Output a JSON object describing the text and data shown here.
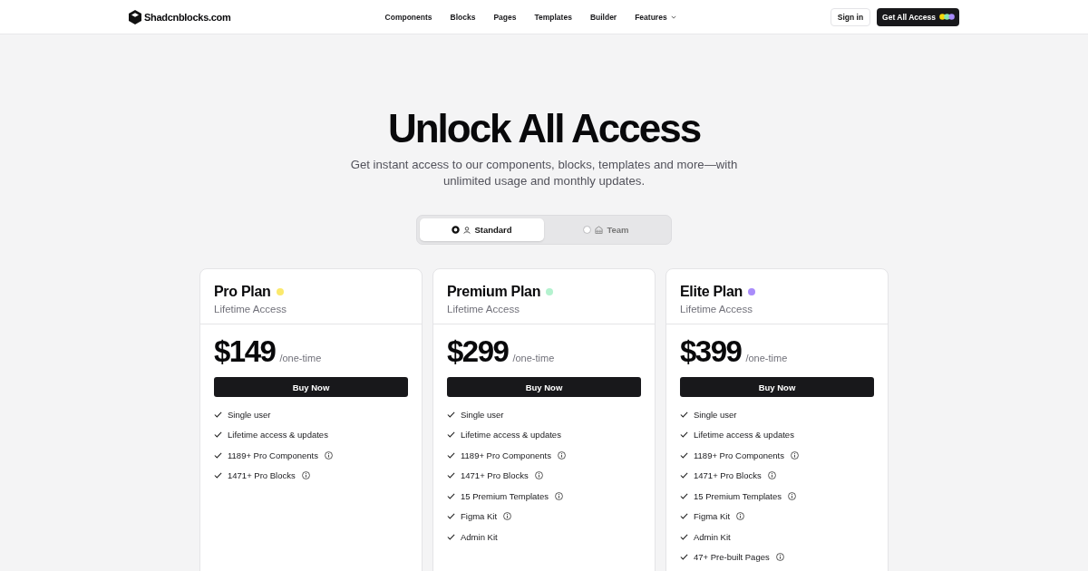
{
  "header": {
    "logo_text": "Shadcnblocks.com",
    "nav": [
      {
        "label": "Components",
        "kind": "link"
      },
      {
        "label": "Blocks",
        "kind": "link"
      },
      {
        "label": "Pages",
        "kind": "link"
      },
      {
        "label": "Templates",
        "kind": "link"
      },
      {
        "label": "Builder",
        "kind": "link"
      },
      {
        "label": "Features",
        "kind": "dropdown"
      }
    ],
    "actions": [
      {
        "label": "Sign in",
        "kind": "outline"
      },
      {
        "label": "Get All Access",
        "kind": "primary"
      }
    ]
  },
  "hero": {
    "title": "Unlock All Access",
    "subtitle": "Get instant access to our components, blocks, templates and more—with unlimited usage and monthly updates."
  },
  "plan_toggle": [
    {
      "label": "Standard",
      "selected": true
    },
    {
      "label": "Team",
      "selected": false
    }
  ],
  "plans": [
    {
      "name": "Pro Plan",
      "color": "#fbe96c",
      "subtitle": "Lifetime Access",
      "price": "$149",
      "period": "/one-time",
      "button": "Buy Now",
      "features": [
        {
          "text": "Single user",
          "info": false
        },
        {
          "text": "Lifetime access & updates",
          "info": false
        },
        {
          "text": "1189+ Pro Components",
          "info": true
        },
        {
          "text": "1471+ Pro Blocks",
          "info": true
        }
      ]
    },
    {
      "name": "Premium Plan",
      "color": "#b4f2cf",
      "subtitle": "Lifetime Access",
      "price": "$299",
      "period": "/one-time",
      "button": "Buy Now",
      "features": [
        {
          "text": "Single user",
          "info": false
        },
        {
          "text": "Lifetime access & updates",
          "info": false
        },
        {
          "text": "1189+ Pro Components",
          "info": true
        },
        {
          "text": "1471+ Pro Blocks",
          "info": true
        },
        {
          "text": "15 Premium Templates",
          "info": true
        },
        {
          "text": "Figma Kit",
          "info": true
        },
        {
          "text": "Admin Kit",
          "info": false
        }
      ]
    },
    {
      "name": "Elite Plan",
      "color": "#a98cfa",
      "subtitle": "Lifetime Access",
      "price": "$399",
      "period": "/one-time",
      "button": "Buy Now",
      "features": [
        {
          "text": "Single user",
          "info": false
        },
        {
          "text": "Lifetime access & updates",
          "info": false
        },
        {
          "text": "1189+ Pro Components",
          "info": true
        },
        {
          "text": "1471+ Pro Blocks",
          "info": true
        },
        {
          "text": "15 Premium Templates",
          "info": true
        },
        {
          "text": "Figma Kit",
          "info": true
        },
        {
          "text": "Admin Kit",
          "info": false
        },
        {
          "text": "47+ Pre-built Pages",
          "info": true
        }
      ]
    }
  ]
}
